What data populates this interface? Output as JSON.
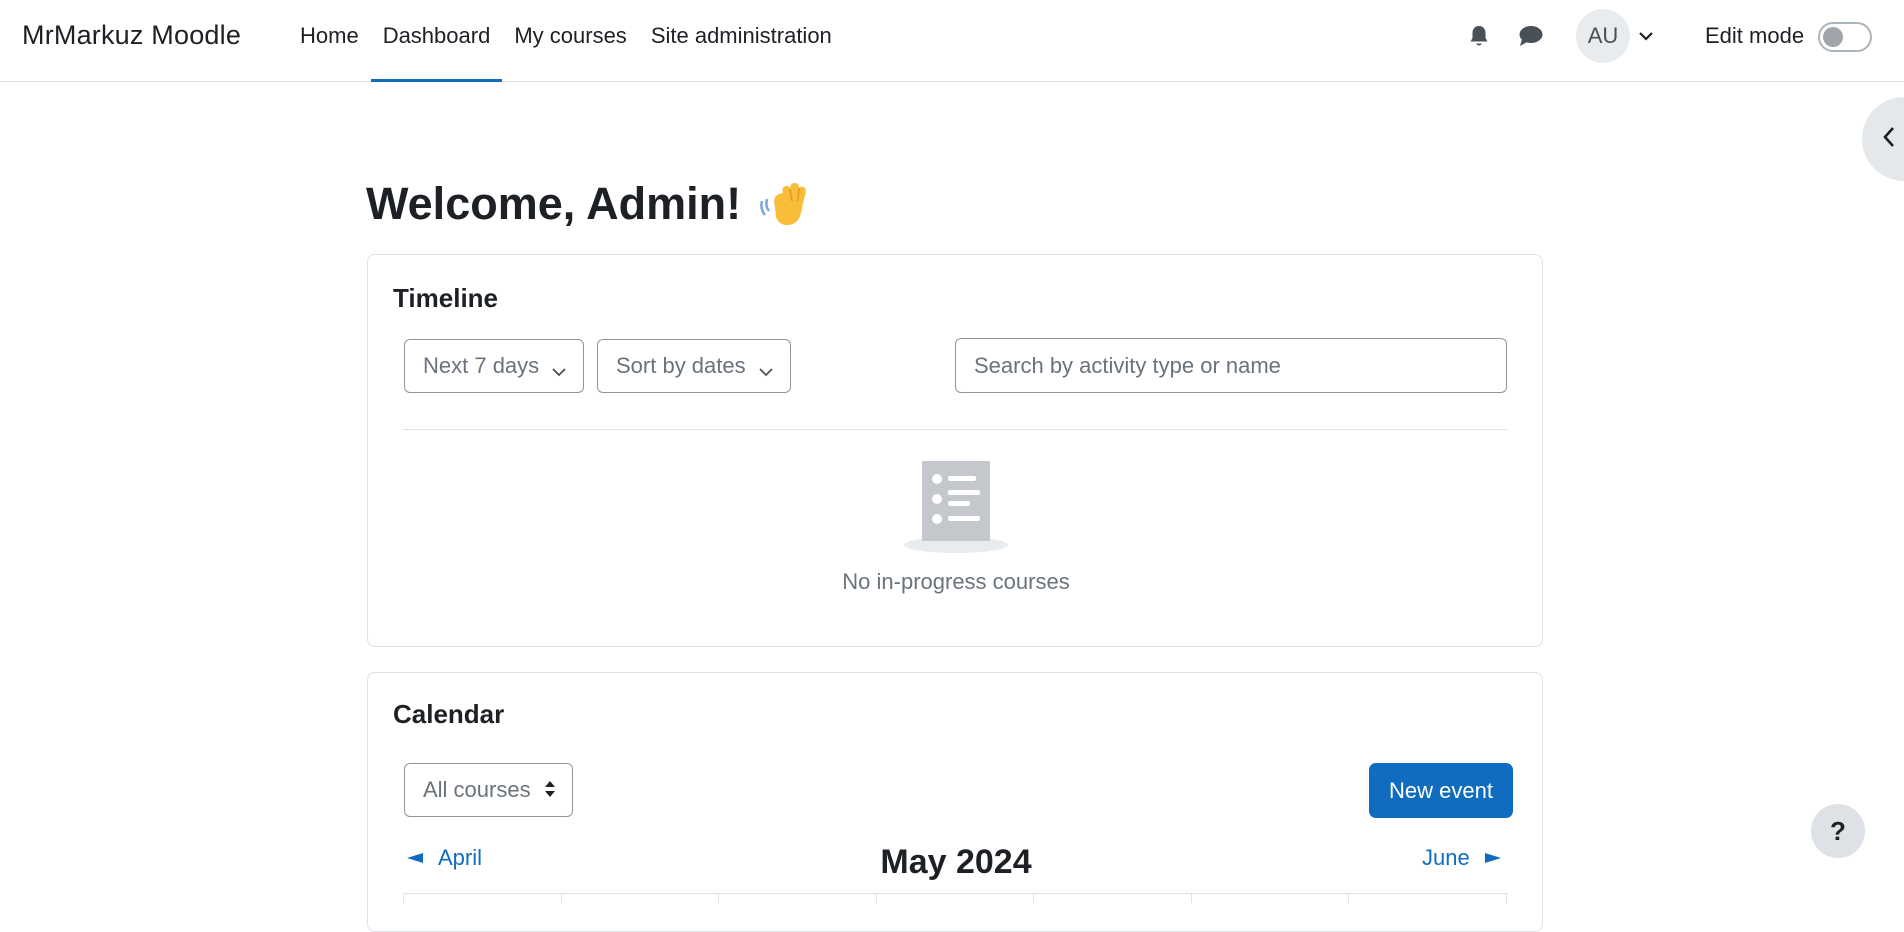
{
  "navbar": {
    "brand": "MrMarkuz Moodle",
    "links": [
      {
        "label": "Home",
        "active": false
      },
      {
        "label": "Dashboard",
        "active": true
      },
      {
        "label": "My courses",
        "active": false
      },
      {
        "label": "Site administration",
        "active": false
      }
    ],
    "notifications_icon": "bell-icon",
    "messages_icon": "chat-bubble-icon",
    "user_initials": "AU",
    "edit_mode_label": "Edit mode",
    "edit_mode_on": false
  },
  "welcome": {
    "heading": "Welcome, Admin!",
    "emoji_icon": "waving-hand-icon"
  },
  "timeline": {
    "title": "Timeline",
    "filter_label": "Next 7 days",
    "sort_label": "Sort by dates",
    "search_placeholder": "Search by activity type or name",
    "search_value": "",
    "empty_icon": "list-document-icon",
    "empty_message": "No in-progress courses"
  },
  "calendar": {
    "title": "Calendar",
    "course_filter": "All courses",
    "new_event_label": "New event",
    "prev_month": "April",
    "current_month": "May 2024",
    "next_month": "June"
  },
  "help_label": "?",
  "colors": {
    "primary": "#0f6cbf",
    "text": "#1d2125",
    "muted": "#6a737b",
    "border": "#dee2e6"
  }
}
